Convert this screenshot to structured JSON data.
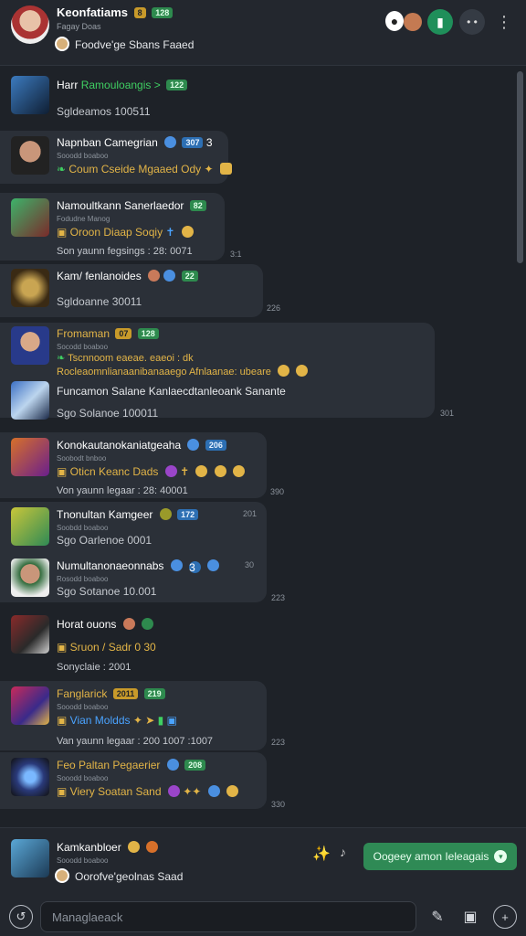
{
  "header": {
    "name": "Keonfatiams",
    "badge_gold": "8",
    "badge_green": "128",
    "subtitle": "Fagay Doas",
    "status": "Foodve'ge Sbans Faaed"
  },
  "messages": [
    {
      "name": "Harr",
      "name_extra": "Ramouloangis >",
      "badge": "122",
      "text": "Sgldeamos 100511",
      "time": ""
    },
    {
      "name": "Napnban Camegrian",
      "badge": "307",
      "extra": "3",
      "meta": "Sooodd boaboo",
      "text": "Coum  Cseide Mgaaed Ody",
      "time": ""
    },
    {
      "name": "Namoultkann Sanerlaedor",
      "badge": "82",
      "meta": "Fodudne  Manog",
      "text": "Oroon  Diaap Soqiy",
      "time": "",
      "sub": "Son yaunn fegsings : 28: 0071",
      "sub_time": "3:1"
    },
    {
      "name": "Kam/ fenlanoides",
      "badge": "22",
      "text": "Sgldoanne  30011",
      "time": "",
      "bubble_time": "226"
    },
    {
      "name": "Fromaman",
      "badge_gold": "07",
      "badge": "128",
      "meta": "Socodd boaboo",
      "text": "Tscnnoom eaeae. eaeoi : dk",
      "text2": "Rocleaomnlianaanibanaaego Afnlaanae: ubeare",
      "time": ""
    },
    {
      "name": "Funcamon",
      "text": "Funcamon Salane  Kanlaecdtanleoank  Sanante",
      "time": "301",
      "sub": "Sgo Solanoe  100011"
    },
    {
      "name": "Konokautanokaniatgeaha",
      "badge": "206",
      "meta": "Soobodt bnboo",
      "text": "Oticn  Keanc  Dads",
      "time": "",
      "sub": "Von yaunn legaar : 28: 40001",
      "sub_time": "390"
    },
    {
      "name": "Tnonultan Kamgeer",
      "badge": "172",
      "meta": "Soobdd boaboo",
      "text": "Sgo Oarlenoe  0001",
      "time": "201"
    },
    {
      "name": "Numultanonaeonnabs",
      "badge": "3",
      "meta": "Rosodd boaboo",
      "text": "Sgo Sotanoe  10.001",
      "time": "30",
      "bubble_time": "223"
    },
    {
      "name": "Horat ouons",
      "text": "Sruon / Sadr  0 30",
      "time": "",
      "sub": "Sonyclaie : 2001"
    },
    {
      "name": "Fanglarick",
      "badge_gold": "2011",
      "badge": "219",
      "meta": "Sooodd boaboo",
      "text": "Vian  Moldds",
      "time": "",
      "sub": "Van yaunn legaar : 200 1007  :1007",
      "sub_time": "223"
    },
    {
      "name": "Feo Paltan Pegaerier",
      "badge": "208",
      "meta": "Sooodd boaboo",
      "text": "Viery  Soatan Sand",
      "time": "330"
    }
  ],
  "footer": {
    "name": "Kamkanbloer",
    "meta": "Sooodd boaboo",
    "status": "Oorofve'geolnas  Saad",
    "join_label": "Oogeey amon  Ieleagais",
    "input_placeholder": "Managlaeack"
  },
  "colors": {
    "accent_green": "#2f8a55",
    "gold": "#e2b447",
    "blue": "#4aa3ff",
    "bg": "#1e2228"
  }
}
